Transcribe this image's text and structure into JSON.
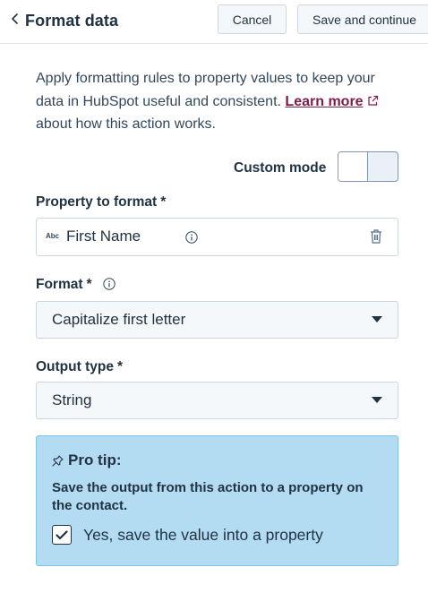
{
  "header": {
    "title": "Format data",
    "cancel_label": "Cancel",
    "save_label": "Save and continue"
  },
  "intro": {
    "text_before": "Apply formatting rules to property values to keep your data in HubSpot useful and consistent.",
    "link_label": "Learn more",
    "text_after": "about how this action works."
  },
  "custom_mode": {
    "label": "Custom mode",
    "enabled": false
  },
  "property_field": {
    "label": "Property to format",
    "required_mark": "*",
    "type_badge": "Abc",
    "value": "First Name"
  },
  "format_field": {
    "label": "Format",
    "required_mark": "*",
    "value": "Capitalize first letter"
  },
  "output_field": {
    "label": "Output type",
    "required_mark": "*",
    "value": "String"
  },
  "pro_tip": {
    "title": "Pro tip:",
    "body": "Save the output from this action to a property on the contact.",
    "checkbox_label": "Yes, save the value into a property",
    "checked": true
  },
  "colors": {
    "text": "#213343",
    "link": "#7d1c4b",
    "tip_background": "#b3dcf2",
    "tip_border": "#7fc2e6",
    "border": "#cbd6e2"
  },
  "icons": {
    "back": "chevron-left-icon",
    "external": "external-link-icon",
    "info": "info-icon",
    "delete": "trash-icon",
    "dropdown": "caret-down-icon",
    "tip": "pin-icon",
    "check": "checkmark-icon"
  }
}
